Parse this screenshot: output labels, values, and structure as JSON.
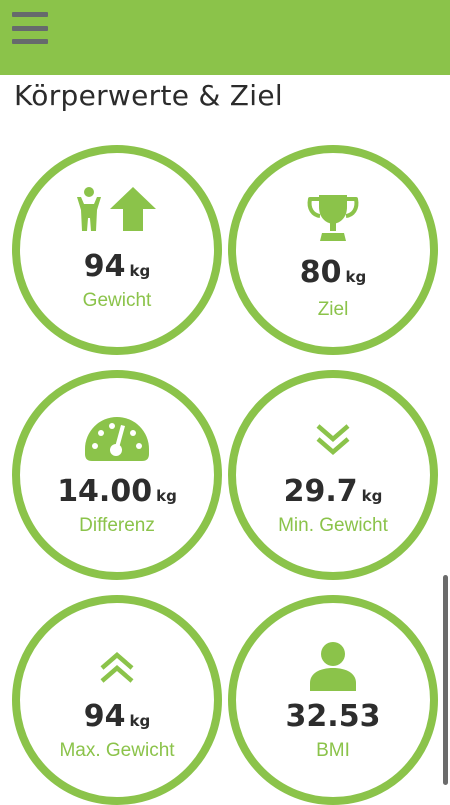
{
  "app": {
    "accent_color": "#8bc34a",
    "menu_icon": "hamburger-menu-icon"
  },
  "section_title": "Körperwerte & Ziel",
  "cards": [
    {
      "icon": "person-arrow-up-icon",
      "value": "94",
      "unit": "kg",
      "label": "Gewicht"
    },
    {
      "icon": "trophy-icon",
      "value": "80",
      "unit": "kg",
      "label": "Ziel"
    },
    {
      "icon": "speedometer-icon",
      "value": "14.00",
      "unit": "kg",
      "label": "Differenz"
    },
    {
      "icon": "double-chevron-down-icon",
      "value": "29.7",
      "unit": "kg",
      "label": "Min. Gewicht"
    },
    {
      "icon": "double-chevron-up-icon",
      "value": "94",
      "unit": "kg",
      "label": "Max. Gewicht"
    },
    {
      "icon": "person-icon",
      "value": "32.53",
      "unit": "",
      "label": "BMI"
    }
  ]
}
